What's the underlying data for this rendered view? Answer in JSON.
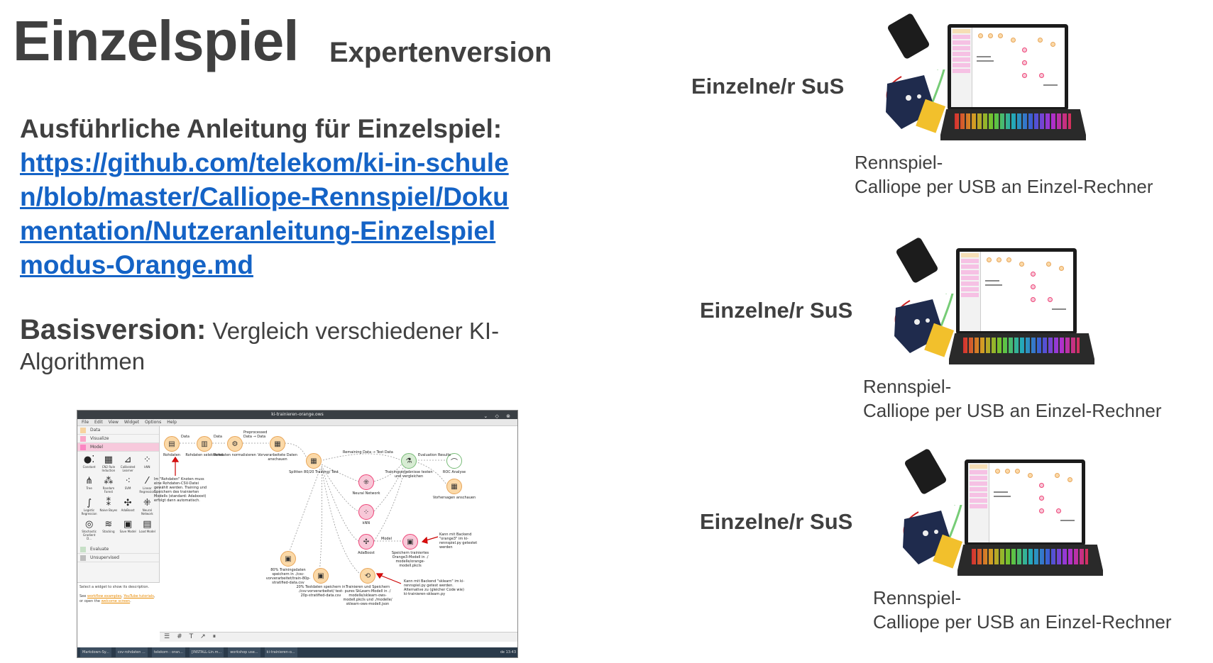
{
  "title": "Einzelspiel",
  "subtitle": "Expertenversion",
  "guide": {
    "heading": "Ausführliche Anleitung für Einzelspiel:",
    "link_text": "https://github.com/telekom/ki-in-schulen/blob/master/Calliope-Rennspiel/Dokumentation/Nutzeranleitung-Einzelspielmodus-Orange.md"
  },
  "basis": {
    "label": "Basisversion:",
    "text": " Vergleich verschiedener KI-Algorithmen"
  },
  "orange_screenshot": {
    "window_title": "ki-trainieren-orange.ows",
    "menu": [
      "File",
      "Edit",
      "View",
      "Widget",
      "Options",
      "Help"
    ],
    "categories": [
      "Data",
      "Visualize",
      "Model",
      "Evaluate",
      "Unsupervised"
    ],
    "widgets": [
      "Constant",
      "CN2 Rule Induction",
      "Calibrated Learner",
      "kNN",
      "Tree",
      "Random Forest",
      "SVM",
      "Linear Regression",
      "Logistic Regression",
      "Naive Bayes",
      "AdaBoost",
      "Neural Network",
      "Stochastic Gradient D...",
      "Stacking",
      "Save Model",
      "Load Model"
    ],
    "description_line1": "Select a widget to show its description.",
    "description_see": "See ",
    "description_link1": "workflow examples",
    "description_link2": "YouTube tutorials",
    "description_or": ", or open the ",
    "description_link3": "welcome screen",
    "nodes": {
      "rohdaten": "Rohdaten",
      "selektieren": "Rohdaten selektieren",
      "normalisieren": "Rohdaten normalisieren",
      "vorverarbeitet": "Vorverarbeitete Daten anschauen",
      "splitten": "Splitten 80/20 Training/ Test",
      "neural": "Neural Network",
      "knn": "kNN",
      "adaboost": "AdaBoost",
      "training": "Trainingsergebnisse testen und vergleichen",
      "roc": "ROC Analyse",
      "vorhersagen": "Vorhersagen anschauen",
      "speichern_orange": "Speichern trainiertes Orange3-Modell in ./ modelle/orange-modell.pkcls",
      "trainingsdaten": "80% Trainingsdaten speichern in ./csv-vorverarbeitet/train-80p-stratified-data.csv",
      "testdaten": "20% Testdaten speichern in ./csv-vorverarbeitet/ test-20p-stratified-data.csv",
      "sklearn": "Trainieren und Speichern pures SkLearn-Modell in ./ modelle/sklearn-ows-modell.pkcls und ./modelle/ sklearn-ows-modell.json"
    },
    "edge_labels": {
      "data1": "Data",
      "data2": "Data",
      "preprocessed": "Preprocessed Data → Data",
      "remaining": "Remaining Data → Test Data",
      "evaluation": "Evaluation Results",
      "model": "Model"
    },
    "notes": {
      "rohdaten_note": "Im \"Rohdaten\" Knoten muss eine Rohdaten-CSV-Datei gewählt werden. Training und Speichern des trainierten Modells (standard: Adaboost) erfolgt dann automatisch.",
      "orange3_note": "Kann mit Backend \"orange3\" im ki-rennspiel.py getestet werden",
      "sklearn_note": "Kann mit Backend \"sklearn\" im ki-rennspiel.py getest werden. Alternative zu (gleicher Code wie) ki-trainieren-sklearn.py"
    },
    "taskbar": [
      "Markdown-Sy...",
      "csv-rohdaten ...",
      "telekom : oran...",
      "[INSTALL-Lin.m...",
      "workshop use...",
      "ki-trainieren-o..."
    ],
    "tray": "de   13:43"
  },
  "setups": [
    {
      "label": "Einzelne/r SuS",
      "caption_line1": "Rennspiel-",
      "caption_line2": "Calliope per USB an Einzel-Rechner"
    },
    {
      "label": "Einzelne/r SuS",
      "caption_line1": "Rennspiel-",
      "caption_line2": "Calliope per USB an Einzel-Rechner"
    },
    {
      "label": "Einzelne/r SuS",
      "caption_line1": "Rennspiel-",
      "caption_line2": "Calliope per USB an Einzel-Rechner"
    }
  ],
  "colors": {
    "link": "#1463c6",
    "text": "#404040",
    "orange_node": "#fbd9a8",
    "model_node": "#f8c8d8"
  }
}
